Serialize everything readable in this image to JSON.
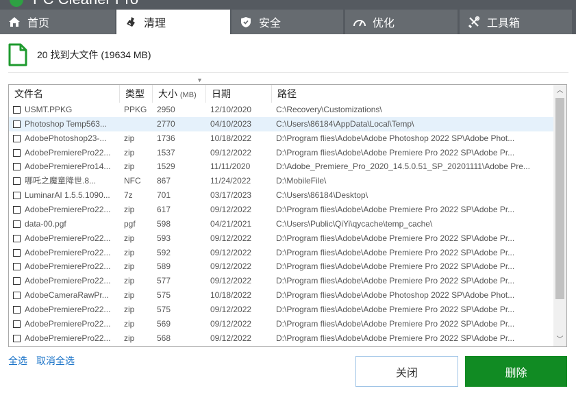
{
  "app": {
    "title": "PC Cleaner Pro"
  },
  "tabs": [
    {
      "label": "首页",
      "icon": "home-icon",
      "active": false
    },
    {
      "label": "清理",
      "icon": "broom-icon",
      "active": true
    },
    {
      "label": "安全",
      "icon": "shield-icon",
      "active": false
    },
    {
      "label": "优化",
      "icon": "speedometer-icon",
      "active": false
    },
    {
      "label": "工具箱",
      "icon": "tools-icon",
      "active": false
    }
  ],
  "summary": {
    "text": "20 找到大文件 (19634 MB)",
    "icon": "file-icon"
  },
  "table": {
    "headers": {
      "name": "文件名",
      "type": "类型",
      "size": "大小",
      "size_unit": "(MB)",
      "date": "日期",
      "path": "路径"
    },
    "rows": [
      {
        "name": "USMT.PPKG",
        "type": "PPKG",
        "size": "2950",
        "date": "12/10/2020",
        "path": "C:\\Recovery\\Customizations\\",
        "selected": false
      },
      {
        "name": "Photoshop Temp563...",
        "type": "",
        "size": "2770",
        "date": "04/10/2023",
        "path": "C:\\Users\\86184\\AppData\\Local\\Temp\\",
        "selected": true
      },
      {
        "name": "AdobePhotoshop23-...",
        "type": "zip",
        "size": "1736",
        "date": "10/18/2022",
        "path": "D:\\Program flies\\Adobe\\Adobe Photoshop 2022 SP\\Adobe Phot...",
        "selected": false
      },
      {
        "name": "AdobePremierePro22...",
        "type": "zip",
        "size": "1537",
        "date": "09/12/2022",
        "path": "D:\\Program flies\\Adobe\\Adobe Premiere Pro 2022 SP\\Adobe Pr...",
        "selected": false
      },
      {
        "name": "AdobePremierePro14...",
        "type": "zip",
        "size": "1529",
        "date": "11/11/2020",
        "path": "D:\\Adobe_Premiere_Pro_2020_14.5.0.51_SP_20201111\\Adobe Pre...",
        "selected": false
      },
      {
        "name": "哪吒之魔童降世.8...",
        "type": "NFC",
        "size": "867",
        "date": "11/24/2022",
        "path": "D:\\MobileFile\\",
        "selected": false
      },
      {
        "name": "LuminarAI 1.5.5.1090...",
        "type": "7z",
        "size": "701",
        "date": "03/17/2023",
        "path": "C:\\Users\\86184\\Desktop\\",
        "selected": false
      },
      {
        "name": "AdobePremierePro22...",
        "type": "zip",
        "size": "617",
        "date": "09/12/2022",
        "path": "D:\\Program flies\\Adobe\\Adobe Premiere Pro 2022 SP\\Adobe Pr...",
        "selected": false
      },
      {
        "name": "data-00.pgf",
        "type": "pgf",
        "size": "598",
        "date": "04/21/2021",
        "path": "C:\\Users\\Public\\QiYi\\qycache\\temp_cache\\",
        "selected": false
      },
      {
        "name": "AdobePremierePro22...",
        "type": "zip",
        "size": "593",
        "date": "09/12/2022",
        "path": "D:\\Program flies\\Adobe\\Adobe Premiere Pro 2022 SP\\Adobe Pr...",
        "selected": false
      },
      {
        "name": "AdobePremierePro22...",
        "type": "zip",
        "size": "592",
        "date": "09/12/2022",
        "path": "D:\\Program flies\\Adobe\\Adobe Premiere Pro 2022 SP\\Adobe Pr...",
        "selected": false
      },
      {
        "name": "AdobePremierePro22...",
        "type": "zip",
        "size": "589",
        "date": "09/12/2022",
        "path": "D:\\Program flies\\Adobe\\Adobe Premiere Pro 2022 SP\\Adobe Pr...",
        "selected": false
      },
      {
        "name": "AdobePremierePro22...",
        "type": "zip",
        "size": "577",
        "date": "09/12/2022",
        "path": "D:\\Program flies\\Adobe\\Adobe Premiere Pro 2022 SP\\Adobe Pr...",
        "selected": false
      },
      {
        "name": "AdobeCameraRawPr...",
        "type": "zip",
        "size": "575",
        "date": "10/18/2022",
        "path": "D:\\Program flies\\Adobe\\Adobe Photoshop 2022 SP\\Adobe Phot...",
        "selected": false
      },
      {
        "name": "AdobePremierePro22...",
        "type": "zip",
        "size": "575",
        "date": "09/12/2022",
        "path": "D:\\Program flies\\Adobe\\Adobe Premiere Pro 2022 SP\\Adobe Pr...",
        "selected": false
      },
      {
        "name": "AdobePremierePro22...",
        "type": "zip",
        "size": "569",
        "date": "09/12/2022",
        "path": "D:\\Program flies\\Adobe\\Adobe Premiere Pro 2022 SP\\Adobe Pr...",
        "selected": false
      },
      {
        "name": "AdobePremierePro22...",
        "type": "zip",
        "size": "568",
        "date": "09/12/2022",
        "path": "D:\\Program flies\\Adobe\\Adobe Premiere Pro 2022 SP\\Adobe Pr...",
        "selected": false
      }
    ]
  },
  "footer": {
    "select_all": "全选",
    "deselect_all": "取消全选",
    "close_label": "关闭",
    "delete_label": "删除"
  },
  "colors": {
    "accent_green": "#118b23",
    "tab_bar": "#555a60",
    "link_blue": "#1a73c8",
    "selected_row": "#e5f1fb"
  }
}
